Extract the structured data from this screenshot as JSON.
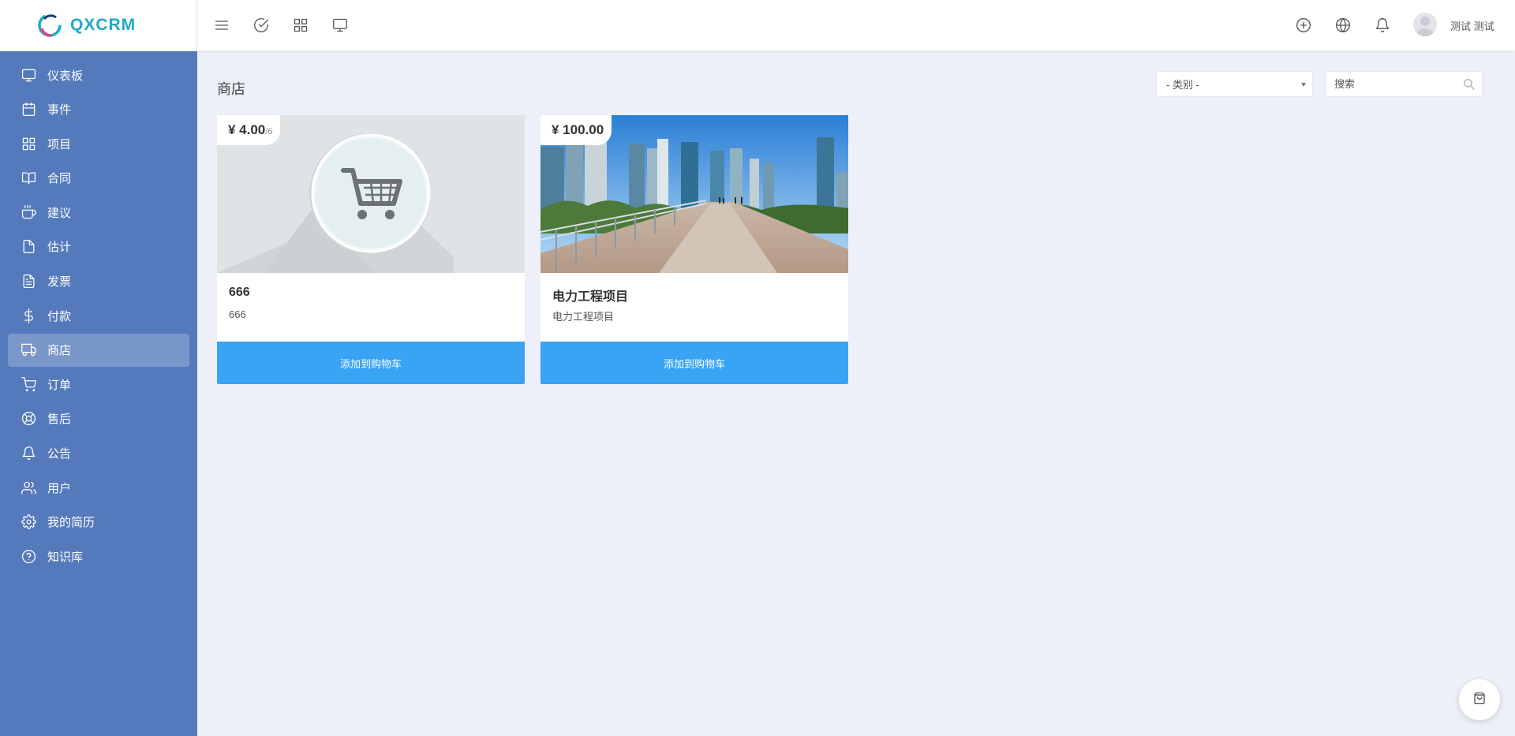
{
  "app": {
    "name": "QXCRM",
    "brand_color": "#1fa8c9"
  },
  "sidebar": {
    "bg_color": "#557abc",
    "items": [
      {
        "label": "仪表板",
        "icon": "monitor-icon",
        "active": false
      },
      {
        "label": "事件",
        "icon": "calendar-icon",
        "active": false
      },
      {
        "label": "项目",
        "icon": "grid-icon",
        "active": false
      },
      {
        "label": "合同",
        "icon": "book-icon",
        "active": false
      },
      {
        "label": "建议",
        "icon": "coffee-icon",
        "active": false
      },
      {
        "label": "估计",
        "icon": "file-icon",
        "active": false
      },
      {
        "label": "发票",
        "icon": "file-text-icon",
        "active": false
      },
      {
        "label": "付款",
        "icon": "dollar-icon",
        "active": false
      },
      {
        "label": "商店",
        "icon": "truck-icon",
        "active": true
      },
      {
        "label": "订单",
        "icon": "cart-icon",
        "active": false
      },
      {
        "label": "售后",
        "icon": "lifebuoy-icon",
        "active": false
      },
      {
        "label": "公告",
        "icon": "bell-icon",
        "active": false
      },
      {
        "label": "用户",
        "icon": "users-icon",
        "active": false
      },
      {
        "label": "我的简历",
        "icon": "settings-icon",
        "active": false
      },
      {
        "label": "知识库",
        "icon": "help-circle-icon",
        "active": false
      }
    ]
  },
  "topbar": {
    "left_icons": [
      "menu-icon",
      "check-circle-icon",
      "apps-grid-icon",
      "monitor-icon"
    ],
    "right_icons": [
      "plus-circle-icon",
      "globe-icon",
      "bell-icon"
    ],
    "username": "测试 测试"
  },
  "main": {
    "title": "商店",
    "category_select": {
      "selected": "- 类别 -"
    },
    "search": {
      "placeholder": "搜索"
    },
    "products": [
      {
        "price": "¥ 4.00",
        "unit": "/6",
        "title": "666",
        "desc": "666",
        "button": "添加到购物车",
        "image": "cart-placeholder-image"
      },
      {
        "price": "¥ 100.00",
        "unit": "",
        "title": "电力工程项目",
        "desc": "电力工程项目",
        "button": "添加到购物车",
        "image": "city-skyline-image"
      }
    ],
    "button_color": "#39a3f4"
  },
  "floating": {
    "icon": "shopping-bag-icon"
  }
}
